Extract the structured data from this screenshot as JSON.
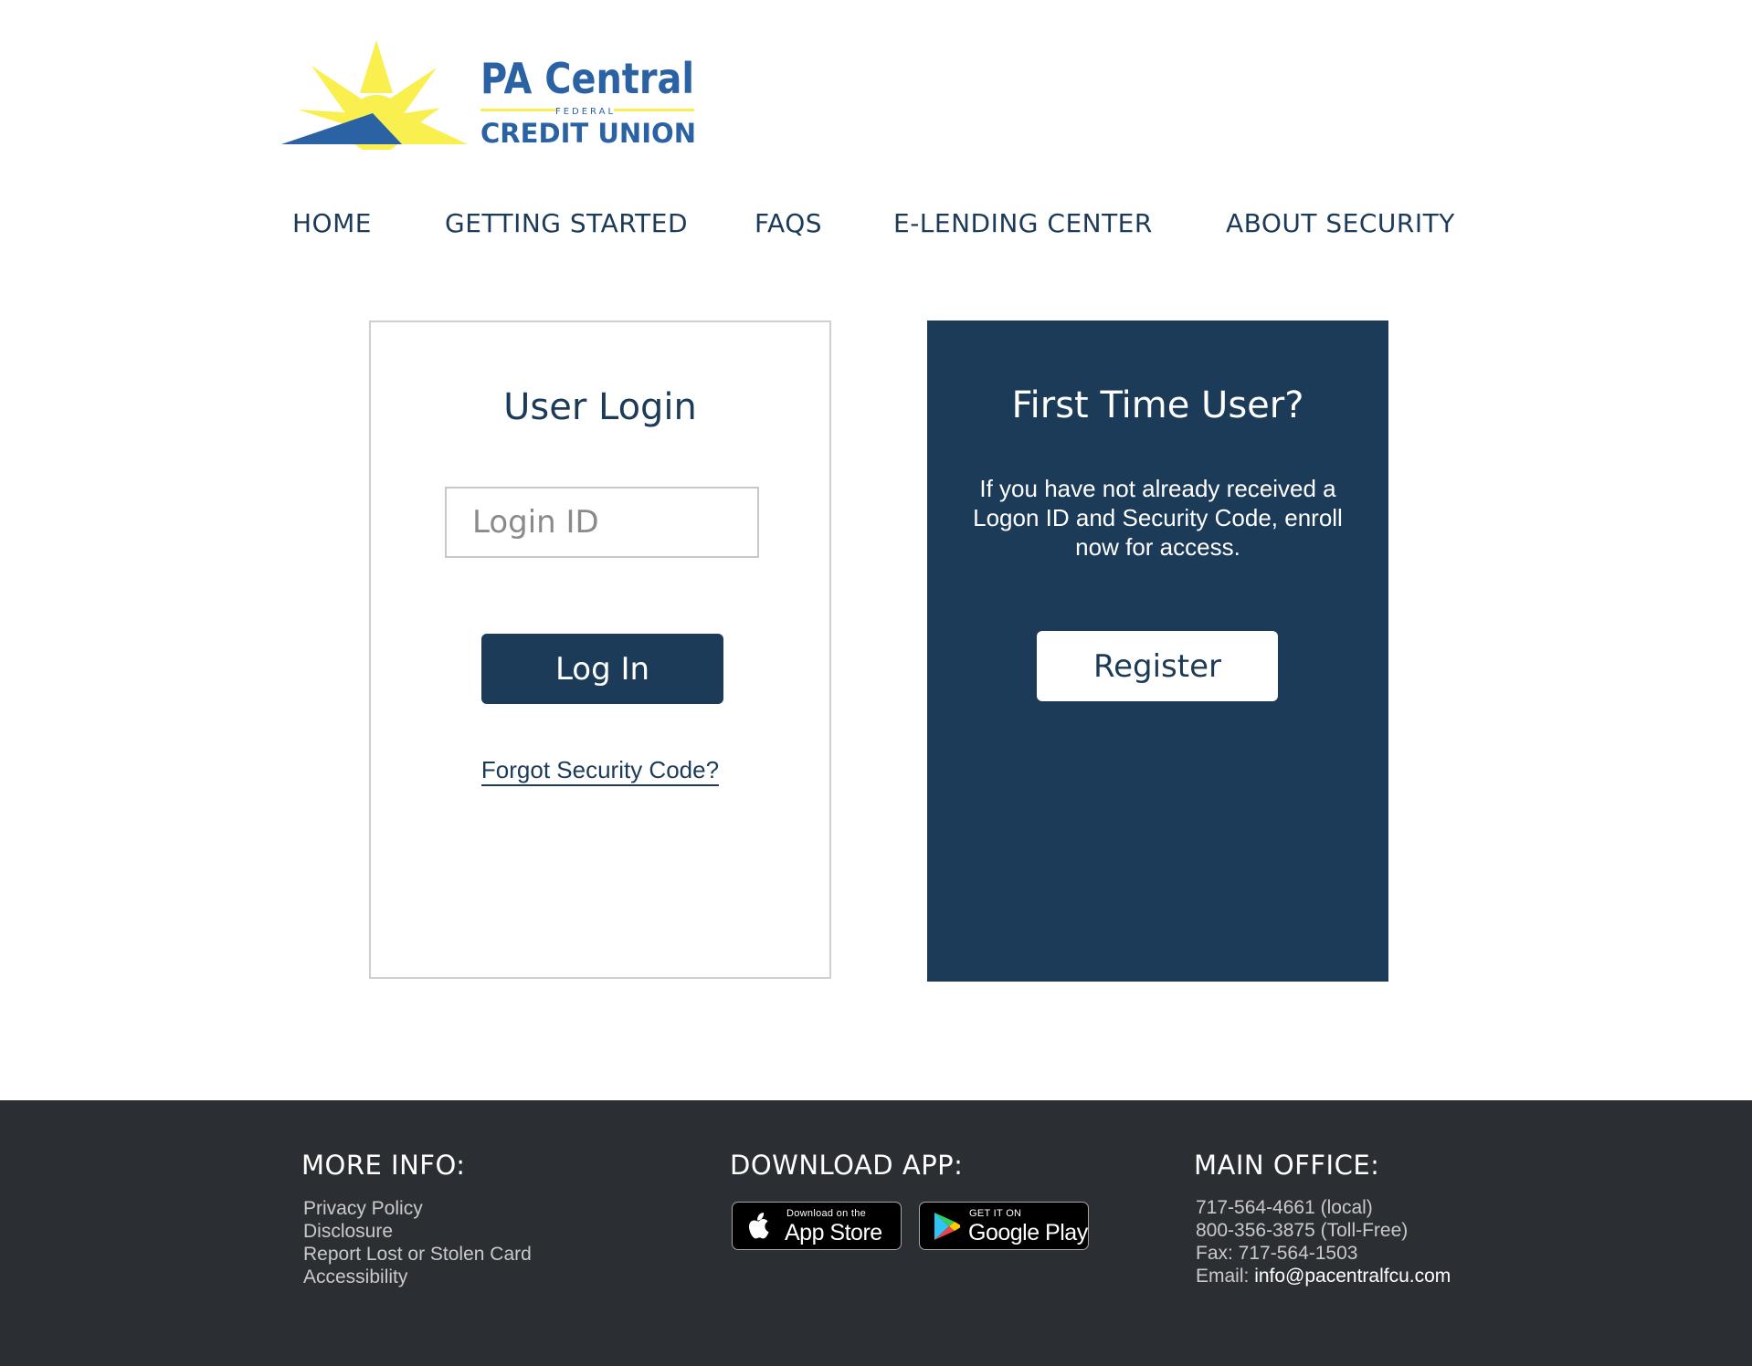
{
  "brand": {
    "name_line1": "PA Central",
    "name_small": "FEDERAL",
    "name_line2": "CREDIT UNION",
    "colors": {
      "navy": "#1c3b58",
      "logo_blue": "#2a62a4",
      "logo_yellow": "#f9ef4e"
    }
  },
  "nav": {
    "items": [
      {
        "label": "HOME"
      },
      {
        "label": "GETTING STARTED"
      },
      {
        "label": "FAQS"
      },
      {
        "label": "E-LENDING CENTER"
      },
      {
        "label": "ABOUT SECURITY"
      }
    ]
  },
  "login": {
    "title": "User Login",
    "login_id_placeholder": "Login ID",
    "login_id_value": "",
    "button_label": "Log In",
    "forgot_link": "Forgot Security Code?"
  },
  "first_time": {
    "title": "First Time User?",
    "description": "If you have not already received a Logon ID and Security Code, enroll now for access.",
    "button_label": "Register"
  },
  "footer": {
    "more_info": {
      "heading": "MORE INFO:",
      "links": [
        "Privacy Policy",
        "Disclosure",
        "Report Lost or Stolen Card",
        "Accessibility"
      ]
    },
    "download_app": {
      "heading": "DOWNLOAD APP:",
      "app_store": {
        "small": "Download on the",
        "big": "App Store",
        "icon": "apple-icon"
      },
      "google_play": {
        "small": "GET IT ON",
        "big": "Google Play",
        "icon": "google-play-icon"
      }
    },
    "main_office": {
      "heading": "MAIN OFFICE:",
      "phone_local": "717-564-4661 (local)",
      "phone_tollfree": "800-356-3875 (Toll-Free)",
      "fax": "Fax: 717-564-1503",
      "email_label": "Email: ",
      "email": "info@pacentralfcu.com"
    },
    "background": "#2b2f33"
  }
}
